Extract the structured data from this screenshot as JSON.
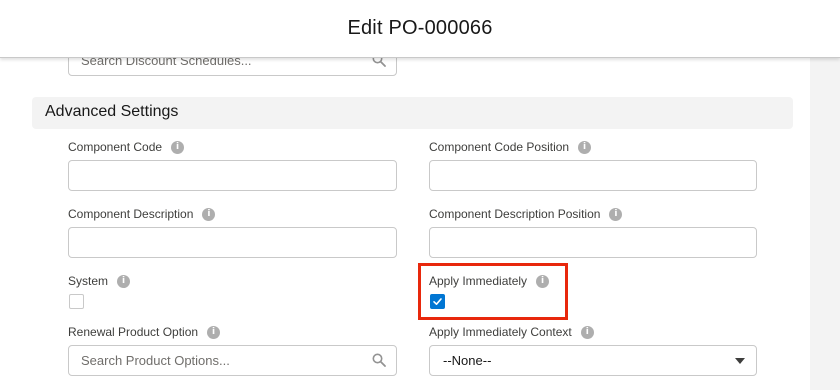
{
  "modal": {
    "title": "Edit PO-000066"
  },
  "discount_schedule": {
    "placeholder": "Search Discount Schedules..."
  },
  "section": {
    "title": "Advanced Settings"
  },
  "fields": {
    "component_code": {
      "label": "Component Code",
      "value": ""
    },
    "component_code_position": {
      "label": "Component Code Position",
      "value": ""
    },
    "component_description": {
      "label": "Component Description",
      "value": ""
    },
    "component_description_position": {
      "label": "Component Description Position",
      "value": ""
    },
    "system": {
      "label": "System",
      "checked": false
    },
    "apply_immediately": {
      "label": "Apply Immediately",
      "checked": true
    },
    "renewal_product_option": {
      "label": "Renewal Product Option",
      "placeholder": "Search Product Options..."
    },
    "apply_immediately_context": {
      "label": "Apply Immediately Context",
      "selected": "--None--"
    }
  },
  "icons": {
    "info": "info-icon",
    "search": "search-icon",
    "check": "check-icon",
    "dropdown": "chevron-down-icon"
  },
  "colors": {
    "accent": "#0176d3",
    "highlight": "#e8280c",
    "section_bg": "#f3f3f3"
  }
}
